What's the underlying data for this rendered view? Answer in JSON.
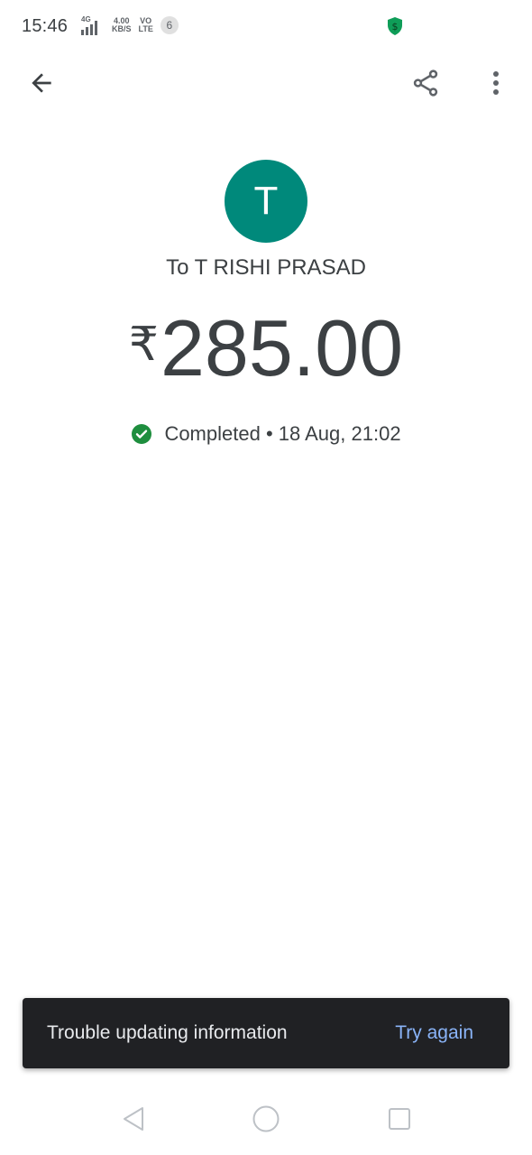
{
  "status_bar": {
    "time": "15:46",
    "network": "4G",
    "speed_value": "4.00",
    "speed_unit": "KB/S",
    "volte_top": "VO",
    "volte_bottom": "LTE",
    "notification_count": "6"
  },
  "colors": {
    "avatar_bg": "#00897b",
    "success_green": "#1e8e3e",
    "snackbar_bg": "#202124",
    "snackbar_action": "#8ab4f8",
    "text_primary": "#3c4043",
    "shield_green": "#0f9d58"
  },
  "icons": {
    "back": "arrow-back-icon",
    "share": "share-icon",
    "more": "more-vert-icon",
    "status": "check-circle-icon",
    "shield": "shield-dollar-icon"
  },
  "transaction": {
    "avatar_initial": "T",
    "recipient": "To T RISHI PRASAD",
    "currency_symbol": "₹",
    "amount": "285.00",
    "status": "Completed",
    "separator": " • ",
    "date_time": "18 Aug, 21:02"
  },
  "snackbar": {
    "message": "Trouble updating information",
    "action": "Try again"
  }
}
